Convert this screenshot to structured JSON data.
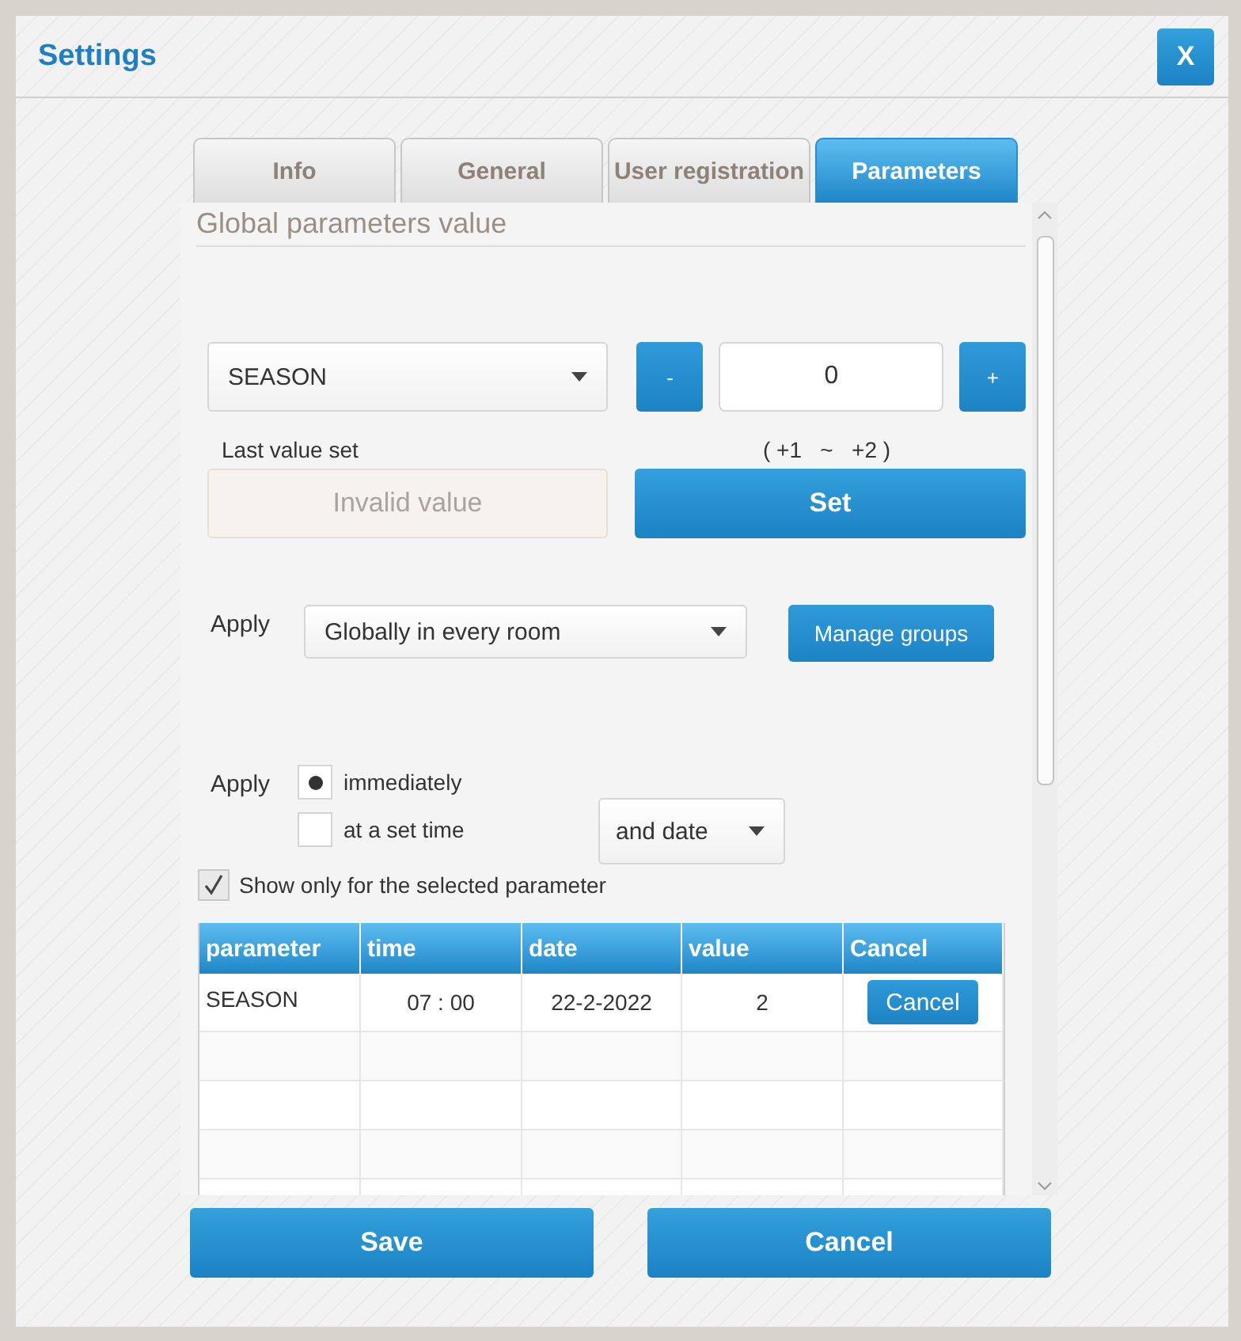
{
  "window": {
    "title": "Settings",
    "close_label": "X"
  },
  "tabs": [
    {
      "label": "Info",
      "selected": false
    },
    {
      "label": "General",
      "selected": false
    },
    {
      "label": "User registration",
      "selected": false
    },
    {
      "label": "Parameters",
      "selected": true
    }
  ],
  "section_title": "Global parameters value",
  "parameter_select": {
    "value": "SEASON"
  },
  "stepper": {
    "minus": "-",
    "value": "0",
    "plus": "+",
    "range": "( +1   ~   +2 )"
  },
  "last_value": {
    "label": "Last value set",
    "value": "Invalid value",
    "disabled": true
  },
  "set_button": "Set",
  "apply_scope": {
    "label": "Apply",
    "value": "Globally in every room",
    "button": "Manage groups"
  },
  "apply_when": {
    "label": "Apply",
    "options": [
      {
        "label": "immediately",
        "selected": true
      },
      {
        "label": "at a set time",
        "selected": false
      }
    ],
    "date_select": "and date"
  },
  "show_only": {
    "label": "Show only for the selected parameter",
    "checked": true
  },
  "table": {
    "columns": [
      "parameter",
      "time",
      "date",
      "value",
      "Cancel"
    ],
    "rows": [
      {
        "parameter": "SEASON",
        "time": "07 : 00",
        "date": "22-2-2022",
        "value": "2",
        "action": "Cancel"
      }
    ]
  },
  "buttons": [
    "Save",
    "Cancel"
  ]
}
